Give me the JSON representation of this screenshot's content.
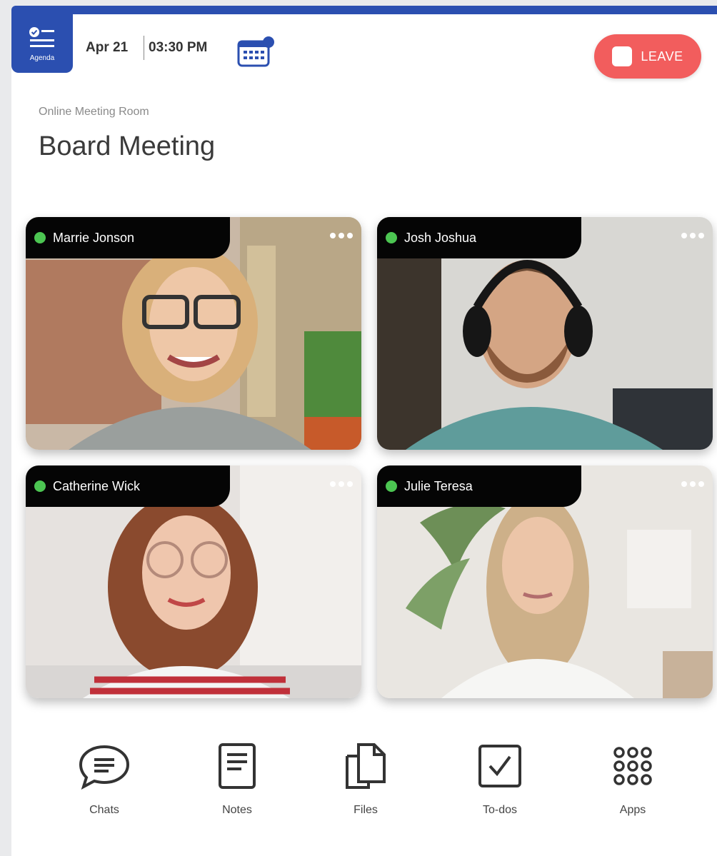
{
  "header": {
    "agenda_label": "Agenda",
    "date": "Apr 21",
    "time": "03:30 PM",
    "leave_label": "LEAVE"
  },
  "room": {
    "subtitle": "Online Meeting Room",
    "title": "Board Meeting"
  },
  "participants": [
    {
      "name": "Marrie Jonson",
      "status": "online"
    },
    {
      "name": "Josh Joshua",
      "status": "online"
    },
    {
      "name": "Catherine Wick",
      "status": "online"
    },
    {
      "name": "Julie Teresa",
      "status": "online"
    }
  ],
  "toolbar": [
    {
      "label": "Chats",
      "icon": "chat-bubble-icon"
    },
    {
      "label": "Notes",
      "icon": "notes-icon"
    },
    {
      "label": "Files",
      "icon": "files-icon"
    },
    {
      "label": "To-dos",
      "icon": "checkbox-icon"
    },
    {
      "label": "Apps",
      "icon": "apps-grid-icon"
    }
  ],
  "colors": {
    "brand": "#2b4fb0",
    "leave": "#f25d5d",
    "online": "#4cc552"
  }
}
